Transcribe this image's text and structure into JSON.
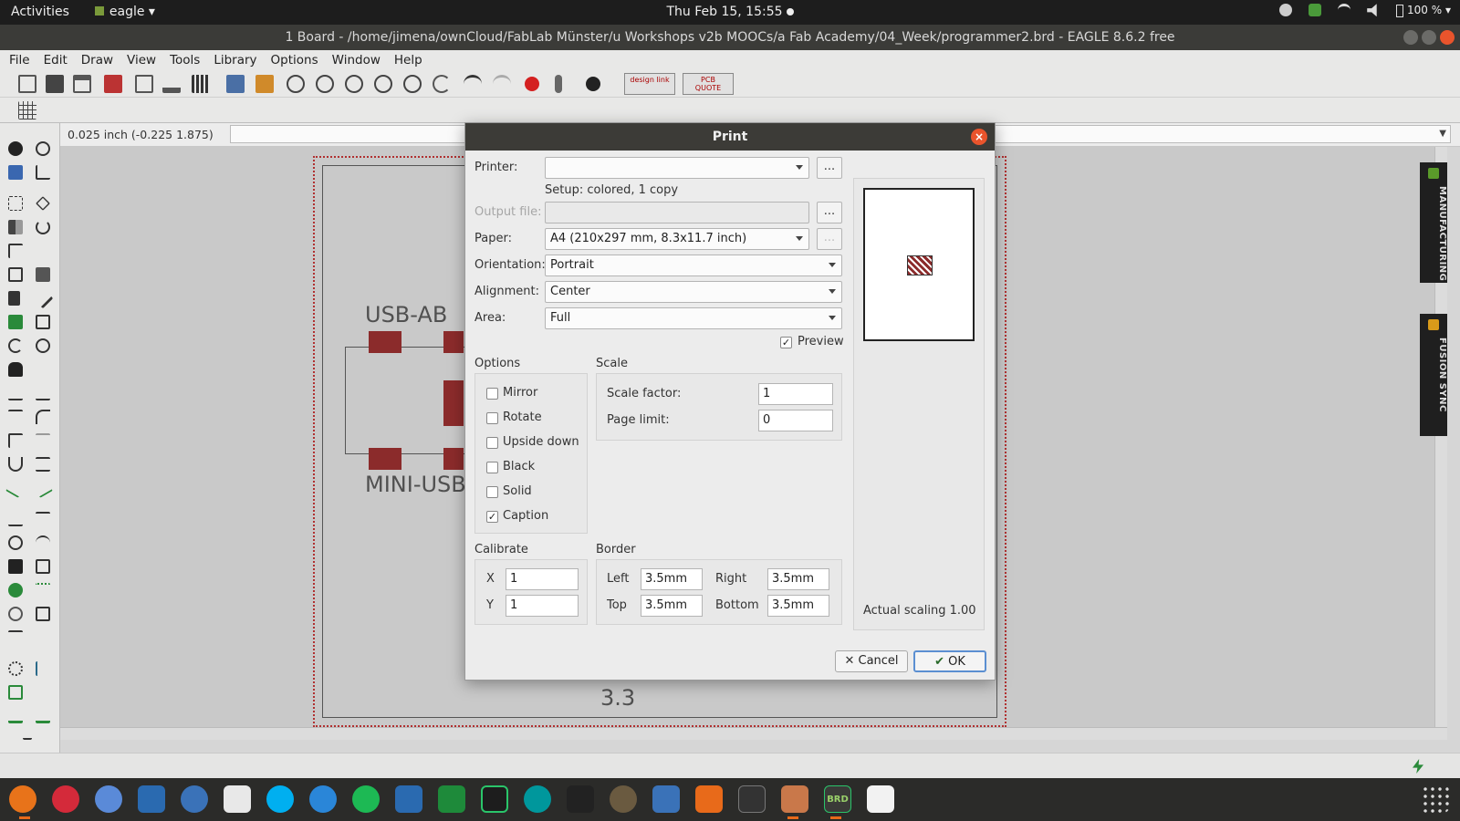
{
  "topbar": {
    "activities": "Activities",
    "app_name": "eagle",
    "datetime": "Thu Feb 15, 15:55",
    "battery": "100 %"
  },
  "window": {
    "title": "1 Board - /home/jimena/ownCloud/FabLab Münster/u Workshops v2b MOOCs/a Fab Academy/04_Week/programmer2.brd - EAGLE 8.6.2 free"
  },
  "menubar": {
    "items": [
      "File",
      "Edit",
      "Draw",
      "View",
      "Tools",
      "Library",
      "Options",
      "Window",
      "Help"
    ]
  },
  "toolbar": {
    "design_link": "design link",
    "pcb_quote": "PCB QUOTE"
  },
  "coordinates": "0.025 inch (-0.225 1.875)",
  "canvas": {
    "labels": [
      "USB-AB",
      "MINI-USB",
      "3.3"
    ]
  },
  "side_tabs": [
    "MANUFACTURING",
    "FUSION SYNC"
  ],
  "dialog": {
    "title": "Print",
    "printer_label": "Printer:",
    "printer_value": "",
    "setup_text": "Setup: colored, 1 copy",
    "output_file_label": "Output file:",
    "output_file_value": "",
    "paper_label": "Paper:",
    "paper_value": "A4 (210x297 mm, 8.3x11.7 inch)",
    "orientation_label": "Orientation:",
    "orientation_value": "Portrait",
    "alignment_label": "Alignment:",
    "alignment_value": "Center",
    "area_label": "Area:",
    "area_value": "Full",
    "preview_label": "Preview",
    "preview_checked": true,
    "options_title": "Options",
    "options": [
      {
        "label": "Mirror",
        "checked": false
      },
      {
        "label": "Rotate",
        "checked": false
      },
      {
        "label": "Upside down",
        "checked": false
      },
      {
        "label": "Black",
        "checked": false
      },
      {
        "label": "Solid",
        "checked": false
      },
      {
        "label": "Caption",
        "checked": true
      }
    ],
    "scale_title": "Scale",
    "scale_factor_label": "Scale factor:",
    "scale_factor_value": "1",
    "page_limit_label": "Page limit:",
    "page_limit_value": "0",
    "calibrate_title": "Calibrate",
    "calibrate_x_label": "X",
    "calibrate_x_value": "1",
    "calibrate_y_label": "Y",
    "calibrate_y_value": "1",
    "border_title": "Border",
    "border_left_label": "Left",
    "border_left_value": "3.5mm",
    "border_right_label": "Right",
    "border_right_value": "3.5mm",
    "border_top_label": "Top",
    "border_top_value": "3.5mm",
    "border_bottom_label": "Bottom",
    "border_bottom_value": "3.5mm",
    "actual_scaling": "Actual scaling 1.00",
    "cancel_label": "Cancel",
    "ok_label": "OK"
  }
}
